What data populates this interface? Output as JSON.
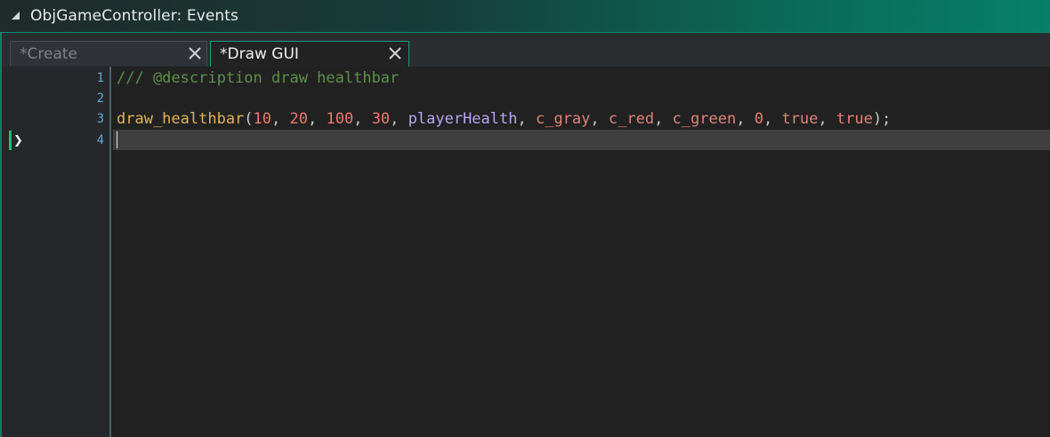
{
  "window": {
    "title": "ObjGameController: Events"
  },
  "tabs": [
    {
      "label": "*Create",
      "active": false
    },
    {
      "label": "*Draw GUI",
      "active": true
    }
  ],
  "editor": {
    "lines": [
      {
        "number": "1",
        "text": "/// @description draw healthbar"
      },
      {
        "number": "2",
        "text": ""
      },
      {
        "number": "3",
        "text": "draw_healthbar(10, 20, 100, 30, playerHealth, c_gray, c_red, c_green, 0, true, true);"
      },
      {
        "number": "4",
        "text": ""
      }
    ],
    "tokens": {
      "comment": "/// @description draw healthbar",
      "func": "draw_healthbar",
      "open": "(",
      "n1": "10",
      "n2": "20",
      "n3": "100",
      "n4": "30",
      "var": "playerHealth",
      "c1": "c_gray",
      "c2": "c_red",
      "c3": "c_green",
      "n5": "0",
      "k1": "true",
      "k2": "true",
      "sep": ", ",
      "close": ");"
    },
    "current_line": "4",
    "icons": {
      "collapse": "collapse-triangle-icon",
      "close": "close-icon",
      "current_line": "current-line-arrow-icon"
    }
  },
  "colors": {
    "accent": "#0a8a70",
    "comment": "#5e8f4c",
    "function": "#e0b25e",
    "number": "#ea7a6e",
    "variable": "#b7a6f2",
    "line_number": "#5fa9d6"
  }
}
